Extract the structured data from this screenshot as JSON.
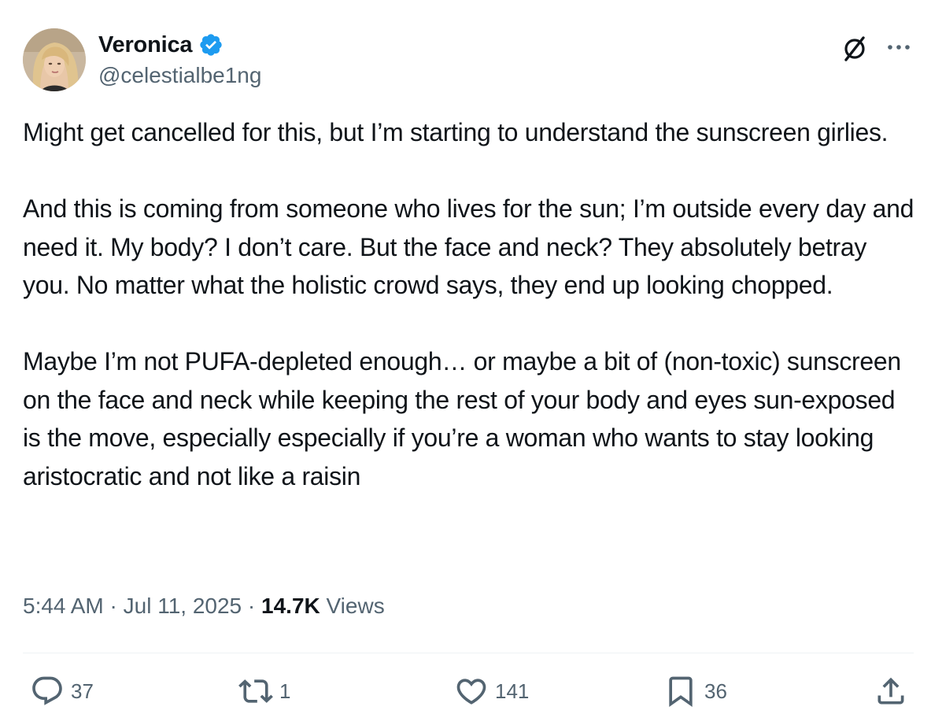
{
  "author": {
    "display_name": "Veronica",
    "handle": "@celestialbe1ng",
    "verified": true
  },
  "icons": {
    "verified": "verified-badge-icon",
    "grok": "grok-icon",
    "more": "more-icon",
    "reply": "reply-icon",
    "retweet": "retweet-icon",
    "like": "heart-icon",
    "bookmark": "bookmark-icon",
    "share": "share-icon"
  },
  "tweet": {
    "paragraphs": [
      "Might get cancelled for this, but I’m starting to understand the sunscreen girlies.",
      "And this is coming from someone who lives for the sun; I’m outside every day and need it. My body? I don’t care. But the face and neck? They absolutely betray you. No matter what the holistic crowd says, they end up looking chopped.",
      "Maybe I’m not PUFA-depleted enough… or maybe a bit of (non-toxic) sunscreen on the face and neck while keeping the rest of your body and eyes sun-exposed is the move, especially especially if you’re a woman who wants to stay looking aristocratic and not like a raisin"
    ],
    "time": "5:44 AM",
    "date": "Jul 11, 2025",
    "separator": " · ",
    "views_count": "14.7K",
    "views_label": " Views"
  },
  "actions": {
    "replies": "37",
    "reposts": "1",
    "likes": "141",
    "bookmarks": "36"
  },
  "colors": {
    "text": "#0f1419",
    "secondary": "#536471",
    "verified": "#1d9bf0",
    "divider": "#eff3f4"
  }
}
